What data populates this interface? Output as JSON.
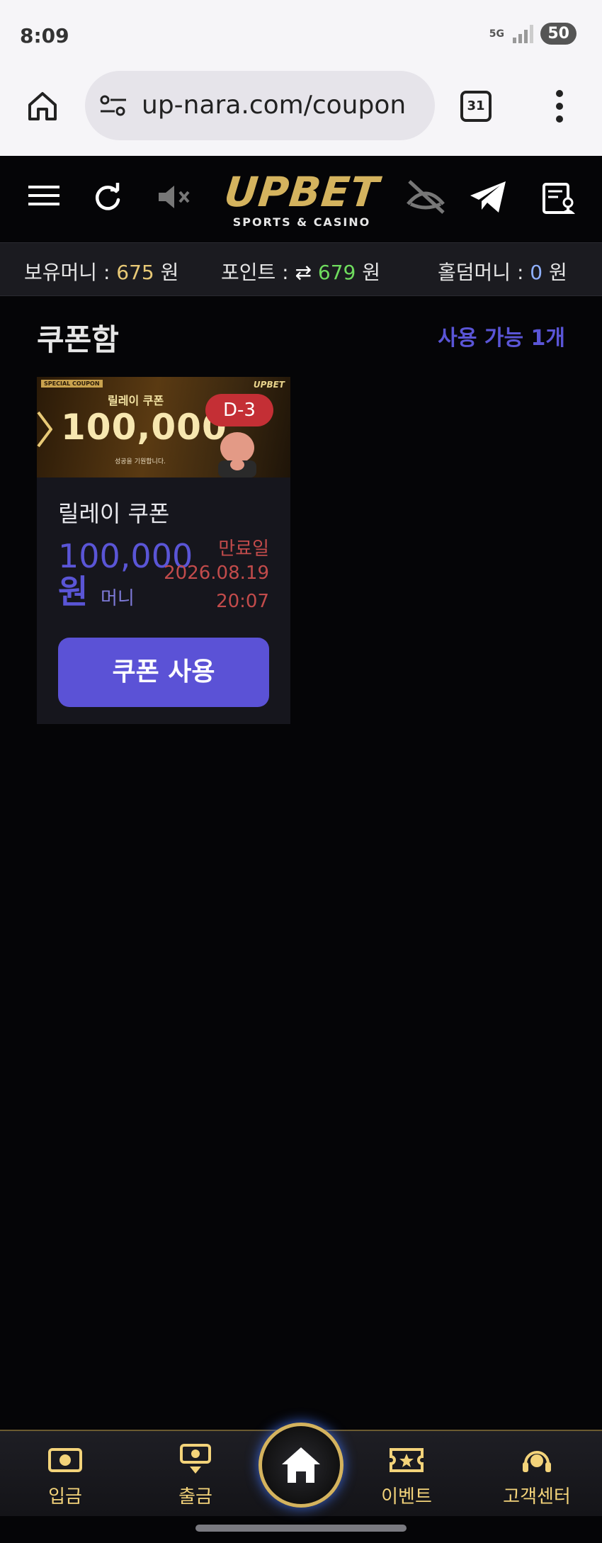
{
  "status_bar": {
    "time": "8:09",
    "network": "5G",
    "battery": "50"
  },
  "browser": {
    "url": "up-nara.com/coupon",
    "tab_count": "31"
  },
  "header": {
    "logo_main": "UPBET",
    "logo_sub": "SPORTS & CASINO"
  },
  "money_bar": {
    "holding_label": "보유머니 : ",
    "holding_value": "675",
    "holding_unit": " 원",
    "point_label": "포인트 : ",
    "point_value": "679",
    "point_unit": " 원",
    "holdem_label": "홀덤머니 : ",
    "holdem_value": "0",
    "holdem_unit": " 원"
  },
  "coupon_box": {
    "title": "쿠폰함",
    "available": "사용 가능 1개"
  },
  "coupon": {
    "banner_special": "SPECIAL COUPON",
    "banner_logo": "UPBET",
    "banner_subtitle": "릴레이 쿠폰",
    "banner_amount": "100,000",
    "banner_tagline": "성공을 기원합니다.",
    "dday": "D-3",
    "name": "릴레이 쿠폰",
    "value": "100,000",
    "won": "원",
    "type": "머니",
    "expire_label": "만료일",
    "expire_date": "2026.08.19",
    "expire_time": "20:07",
    "use_button": "쿠폰 사용"
  },
  "bottom_nav": {
    "deposit": "입금",
    "withdraw": "출금",
    "event": "이벤트",
    "support": "고객센터"
  },
  "colors": {
    "accent_purple": "#5b52d6",
    "gold": "#d4b35e",
    "expire_red": "#c24b4b",
    "point_green": "#6fdc5e"
  }
}
